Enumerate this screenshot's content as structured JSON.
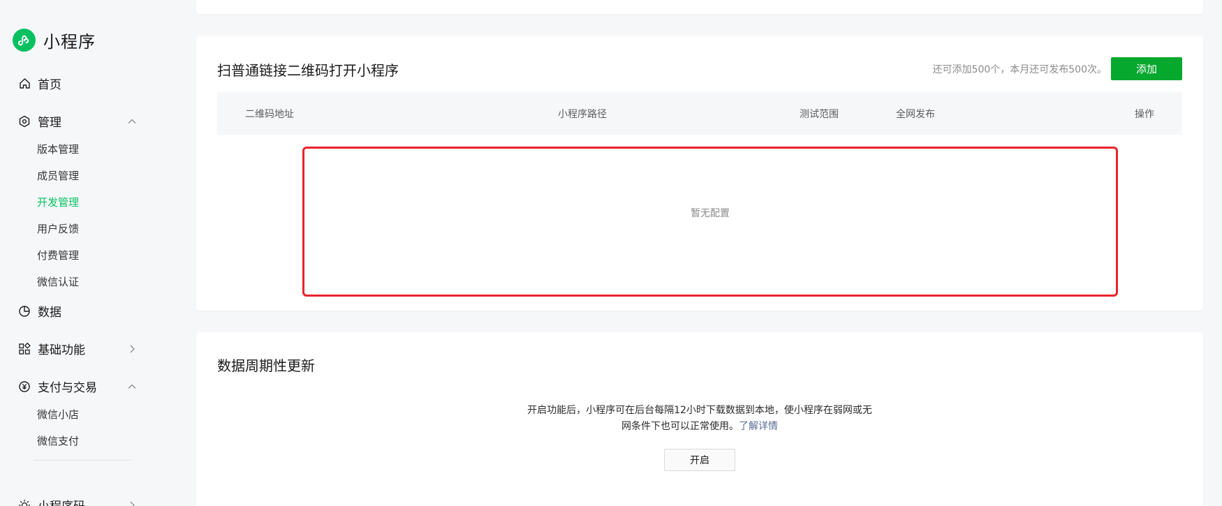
{
  "brand": {
    "title": "小程序",
    "accent": "#07c160",
    "icon": "mini-program-logo-icon"
  },
  "sidebar": {
    "home": {
      "label": "首页",
      "icon": "home-icon"
    },
    "manage": {
      "label": "管理",
      "icon": "manage-hexagon-icon",
      "expanded": true,
      "items": [
        "版本管理",
        "成员管理",
        "开发管理",
        "用户反馈",
        "付费管理",
        "微信认证"
      ],
      "active_item": "开发管理"
    },
    "data": {
      "label": "数据",
      "icon": "pie-chart-icon"
    },
    "basic": {
      "label": "基础功能",
      "icon": "apps-grid-icon",
      "expanded": false
    },
    "pay": {
      "label": "支付与交易",
      "icon": "yen-circle-icon",
      "expanded": true,
      "items": [
        "微信小店",
        "微信支付"
      ]
    },
    "qrcode": {
      "label": "小程序码",
      "icon": "sun-icon",
      "expanded": false
    }
  },
  "qr_section": {
    "title": "扫普通链接二维码打开小程序",
    "quota": "还可添加500个，本月还可发布500次。",
    "add_label": "添加",
    "columns": [
      "二维码地址",
      "小程序路径",
      "测试范围",
      "全网发布",
      "操作"
    ],
    "empty_text": "暂无配置",
    "highlight_color": "#e8242c"
  },
  "sync_section": {
    "title": "数据周期性更新",
    "desc_line1": "开启功能后，小程序可在后台每隔12小时下载数据到本地，使小程序在弱网或无",
    "desc_line2": "网条件下也可以正常使用。",
    "link": "了解详情",
    "enable_label": "开启"
  }
}
